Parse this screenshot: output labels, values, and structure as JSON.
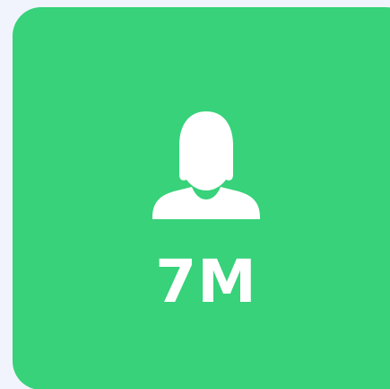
{
  "card": {
    "icon": "female-user-icon",
    "value": "7M",
    "background_color": "#37d27a",
    "foreground_color": "#ffffff"
  },
  "page": {
    "background_color": "#f1f4fd"
  }
}
